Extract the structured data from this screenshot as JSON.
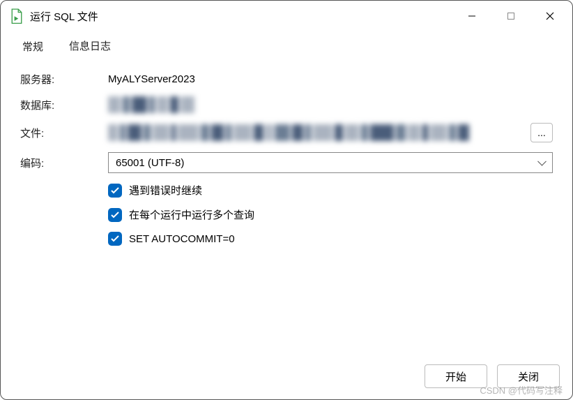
{
  "window": {
    "title": "运行 SQL 文件"
  },
  "tabs": {
    "general": "常规",
    "log": "信息日志"
  },
  "form": {
    "serverLabel": "服务器:",
    "serverValue": "MyALYServer2023",
    "databaseLabel": "数据库:",
    "fileLabel": "文件:",
    "fileBrowse": "...",
    "encodingLabel": "编码:",
    "encodingValue": "65001 (UTF-8)"
  },
  "checkboxes": {
    "continueOnError": "遇到错误时继续",
    "multiQuery": "在每个运行中运行多个查询",
    "autocommit": "SET AUTOCOMMIT=0"
  },
  "footer": {
    "start": "开始",
    "close": "关闭"
  },
  "watermark": "CSDN @代码写注释"
}
